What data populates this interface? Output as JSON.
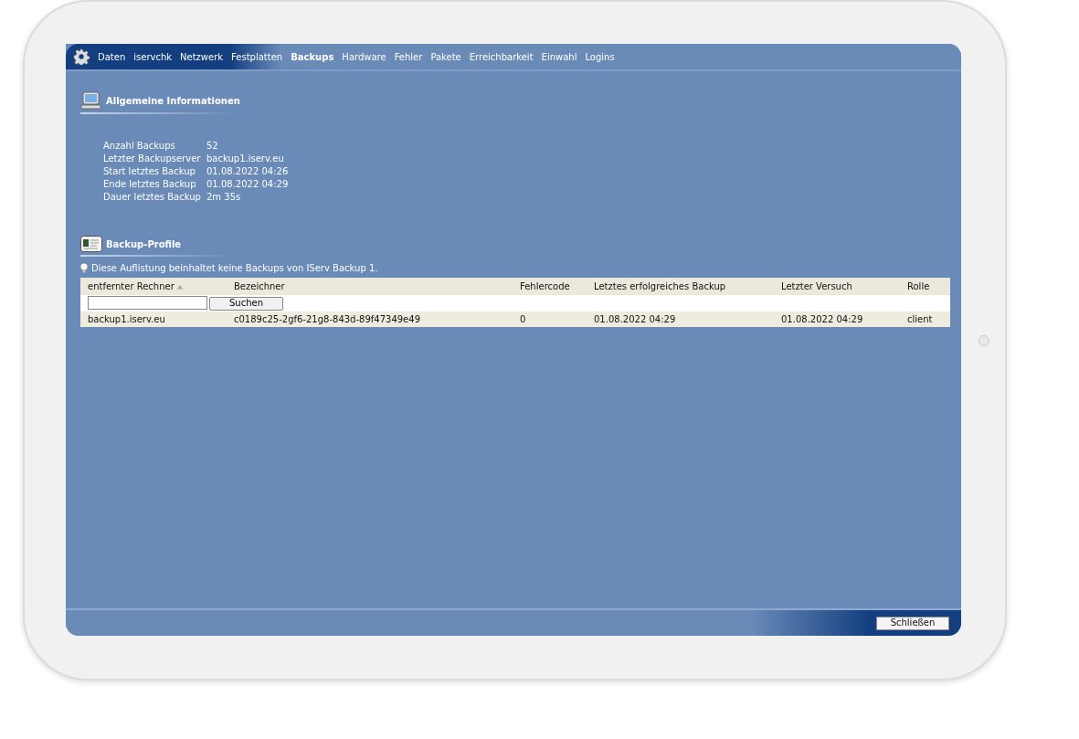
{
  "nav": {
    "items": [
      {
        "label": "Daten",
        "selected": false
      },
      {
        "label": "iservchk",
        "selected": false
      },
      {
        "label": "Netzwerk",
        "selected": false
      },
      {
        "label": "Festplatten",
        "selected": false
      },
      {
        "label": "Backups",
        "selected": true
      },
      {
        "label": "Hardware",
        "selected": false
      },
      {
        "label": "Fehler",
        "selected": false
      },
      {
        "label": "Pakete",
        "selected": false
      },
      {
        "label": "Erreichbarkeit",
        "selected": false
      },
      {
        "label": "Einwahl",
        "selected": false
      },
      {
        "label": "Logins",
        "selected": false
      }
    ]
  },
  "general_info": {
    "title": "Allgemeine Informationen",
    "rows": [
      {
        "label": "Anzahl Backups",
        "value": "52"
      },
      {
        "label": "Letzter Backupserver",
        "value": "backup1.iserv.eu"
      },
      {
        "label": "Start letztes Backup",
        "value": "01.08.2022 04:26"
      },
      {
        "label": "Ende letztes Backup",
        "value": "01.08.2022 04:29"
      },
      {
        "label": "Dauer letztes Backup",
        "value": "2m 35s"
      }
    ]
  },
  "backup_profiles": {
    "title": "Backup-Profile",
    "hint": "Diese Auflistung beinhaltet keine Backups von IServ Backup 1.",
    "columns": [
      {
        "label": "entfernter Rechner",
        "sorted": true
      },
      {
        "label": "Bezeichner",
        "sorted": false
      },
      {
        "label": "Fehlercode",
        "sorted": false
      },
      {
        "label": "Letztes erfolgreiches Backup",
        "sorted": false
      },
      {
        "label": "Letzter Versuch",
        "sorted": false
      },
      {
        "label": "Rolle",
        "sorted": false
      }
    ],
    "search_button": "Suchen",
    "rows": [
      [
        "backup1.iserv.eu",
        "c0189c25-2gf6-21g8-843d-89f47349e49",
        "0",
        "01.08.2022 04:29",
        "01.08.2022 04:29",
        "client"
      ]
    ]
  },
  "footer": {
    "close_button": "Schließen"
  }
}
